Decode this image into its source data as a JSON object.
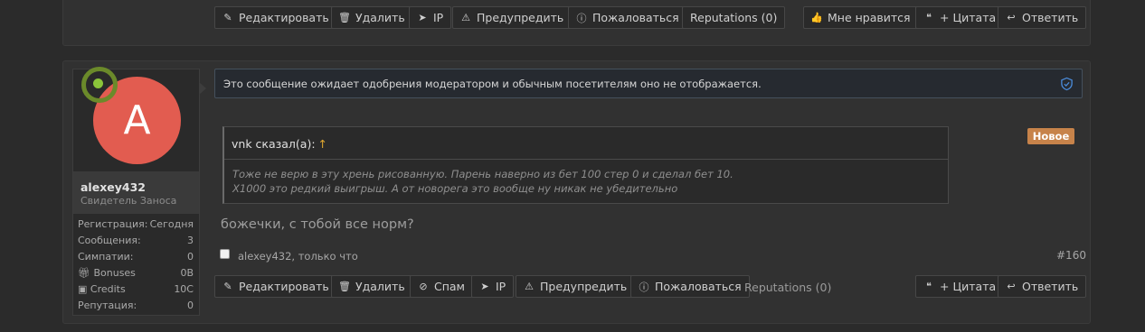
{
  "top_post": {
    "actions_left": [
      {
        "label": "Редактировать",
        "icon": "pencil-icon"
      },
      {
        "label": "Удалить",
        "icon": "trash-icon"
      },
      {
        "label": "IP",
        "icon": "location-arrow-icon"
      },
      {
        "label": "Предупредить",
        "icon": "warning-icon"
      },
      {
        "label": "Пожаловаться",
        "icon": "info-icon"
      },
      {
        "label": "Reputations (0)",
        "icon": ""
      }
    ],
    "actions_right": [
      {
        "label": "Мне нравится",
        "icon": "thumbs-up-icon"
      },
      {
        "label": "+ Цитата",
        "icon": "quote-icon"
      },
      {
        "label": "Ответить",
        "icon": "reply-icon"
      }
    ]
  },
  "post": {
    "user": {
      "avatar_letter": "A",
      "avatar_color": "#e25c50",
      "online_color": "#8bc43a",
      "username": "alexey432",
      "title": "Свидетель Заноса",
      "stats": [
        {
          "key": "Регистрация:",
          "value": "Сегодня",
          "icon": ""
        },
        {
          "key": "Сообщения:",
          "value": "3",
          "icon": ""
        },
        {
          "key": "Симпатии:",
          "value": "0",
          "icon": ""
        },
        {
          "key": "Bonuses",
          "value": "0B",
          "icon": "gift-icon"
        },
        {
          "key": "Credits",
          "value": "10C",
          "icon": "money-icon"
        },
        {
          "key": "Репутация:",
          "value": "0",
          "icon": ""
        }
      ]
    },
    "moderation_notice": "Это сообщение ожидает одобрения модератором и обычным посетителям оно не отображается.",
    "badge_new": "Новое",
    "badge_color": "#c7834a",
    "quote": {
      "author": "vnk сказал(а):",
      "arrow": "↑",
      "lines": [
        "Тоже не верю в эту хрень рисованную. Парень наверно из бет 100 стер 0 и сделал бет 10.",
        "X1000 это редкий выигрыш. А от новорега это вообще ну никак не убедительно"
      ]
    },
    "message": "божечки, с тобой все норм?",
    "meta": "alexey432, только что",
    "post_number": "#160",
    "actions_left": [
      {
        "label": "Редактировать",
        "icon": "pencil-icon"
      },
      {
        "label": "Удалить",
        "icon": "trash-icon"
      },
      {
        "label": "Спам",
        "icon": "ban-icon"
      },
      {
        "label": "IP",
        "icon": "location-arrow-icon"
      },
      {
        "label": "Предупредить",
        "icon": "warning-icon"
      },
      {
        "label": "Пожаловаться",
        "icon": "info-icon"
      }
    ],
    "reputations": "Reputations (0)",
    "actions_right": [
      {
        "label": "+ Цитата",
        "icon": "quote-icon"
      },
      {
        "label": "Ответить",
        "icon": "reply-icon"
      }
    ]
  }
}
